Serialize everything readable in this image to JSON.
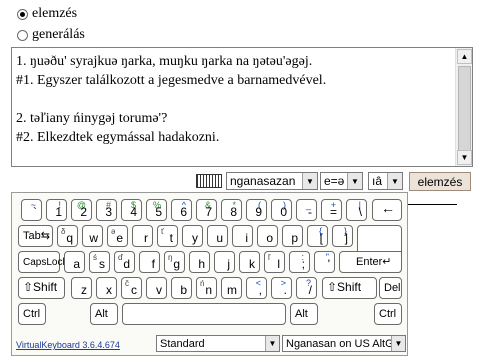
{
  "mode": {
    "options": [
      {
        "label": "elemzés",
        "checked": true
      },
      {
        "label": "generálás",
        "checked": false
      }
    ]
  },
  "text_lines": [
    "1. ŋuəðu' syrajkuə ŋarka, muŋku ŋarka na ŋətəu'əgəj.",
    "#1. Egyszer találkozott a jegesmedve a barnamedvével.",
    "",
    "2. təľiany ńinygəj torumə'?",
    "#2. Elkezdtek egymással hadakozni."
  ],
  "toolbar": {
    "keyboard_icon": "keyboard-icon",
    "language": "nganasazan",
    "mapping": "e=ə",
    "symbol": "ıâ",
    "analyze_label": "elemzés"
  },
  "keyboard": {
    "rows": [
      [
        {
          "id": "backtick",
          "sup": "",
          "sub": "",
          "main": "`",
          "alt": "~"
        },
        {
          "id": "1",
          "sup": "",
          "sub": "",
          "main": "1",
          "alt": "!"
        },
        {
          "id": "2",
          "sup": "",
          "sub": "",
          "main": "2",
          "alt": "@"
        },
        {
          "id": "3",
          "sup": "",
          "sub": "",
          "main": "3",
          "alt": "#"
        },
        {
          "id": "4",
          "sup": "",
          "sub": "",
          "main": "4",
          "alt": "$"
        },
        {
          "id": "5",
          "sup": "",
          "sub": "",
          "main": "5",
          "alt": "%"
        },
        {
          "id": "6",
          "sup": "",
          "sub": "",
          "main": "6",
          "alt": "^"
        },
        {
          "id": "7",
          "sup": "",
          "sub": "",
          "main": "7",
          "alt": "&"
        },
        {
          "id": "8",
          "sup": "",
          "sub": "",
          "main": "8",
          "alt": "*"
        },
        {
          "id": "9",
          "sup": "",
          "sub": "",
          "main": "9",
          "alt": "("
        },
        {
          "id": "0",
          "sup": "",
          "sub": "",
          "main": "0",
          "alt": ")"
        },
        {
          "id": "minus",
          "sup": "",
          "sub": "",
          "main": "-",
          "alt": "_"
        },
        {
          "id": "equals",
          "sup": "",
          "sub": "",
          "main": "=",
          "alt": "+"
        },
        {
          "id": "backslash",
          "sup": "",
          "sub": "",
          "main": "\\",
          "alt": "|"
        }
      ],
      [
        {
          "id": "q",
          "sub": "δ",
          "main": "q"
        },
        {
          "id": "w",
          "sub": "",
          "main": "w"
        },
        {
          "id": "e",
          "sub": "ə",
          "main": "e"
        },
        {
          "id": "r",
          "sub": "",
          "main": "r"
        },
        {
          "id": "t",
          "sub": "ť",
          "main": "t"
        },
        {
          "id": "y",
          "sub": "",
          "main": "y"
        },
        {
          "id": "u",
          "sub": "",
          "main": "u"
        },
        {
          "id": "i",
          "sub": "",
          "main": "i"
        },
        {
          "id": "o",
          "sub": "",
          "main": "o"
        },
        {
          "id": "p",
          "sub": "",
          "main": "p"
        },
        {
          "id": "lbracket",
          "sub": "",
          "main": "[",
          "alt": "{"
        },
        {
          "id": "rbracket",
          "sub": "",
          "main": "]",
          "alt": "}"
        }
      ],
      [
        {
          "id": "a",
          "sub": "",
          "main": "a"
        },
        {
          "id": "s",
          "sub": "ś",
          "main": "s"
        },
        {
          "id": "d",
          "sub": "ď",
          "main": "d"
        },
        {
          "id": "f",
          "sub": "",
          "main": "f"
        },
        {
          "id": "g",
          "sub": "ŋ",
          "main": "g"
        },
        {
          "id": "h",
          "sub": "",
          "main": "h"
        },
        {
          "id": "j",
          "sub": "",
          "main": "j"
        },
        {
          "id": "k",
          "sub": "",
          "main": "k"
        },
        {
          "id": "l",
          "sub": "ľ",
          "main": "l"
        },
        {
          "id": "semicolon",
          "sub": "",
          "main": ";",
          "alt": ":"
        },
        {
          "id": "quote",
          "sub": "",
          "main": "'",
          "alt": "\""
        }
      ],
      [
        {
          "id": "z",
          "sub": "",
          "main": "z"
        },
        {
          "id": "x",
          "sub": "",
          "main": "x"
        },
        {
          "id": "c",
          "sub": "č",
          "main": "c"
        },
        {
          "id": "v",
          "sub": "",
          "main": "v"
        },
        {
          "id": "b",
          "sub": "",
          "main": "b"
        },
        {
          "id": "n",
          "sub": "ń",
          "main": "n"
        },
        {
          "id": "m",
          "sub": "",
          "main": "m"
        },
        {
          "id": "comma",
          "sub": "",
          "main": ",",
          "alt": "<"
        },
        {
          "id": "period",
          "sub": "",
          "main": ".",
          "alt": ">"
        },
        {
          "id": "slash",
          "sub": "",
          "main": "/",
          "alt": "?"
        }
      ]
    ],
    "func": {
      "backspace": "←",
      "tab": "Tab⇆",
      "capslock": "CapsLock",
      "enter": "Enter↵",
      "shift_left": "⇧Shift",
      "shift_right": "⇧Shift",
      "del": "Del",
      "ctrl_left": "Ctrl",
      "alt_left": "Alt",
      "alt_right": "Alt",
      "ctrl_right": "Ctrl"
    }
  },
  "footer": {
    "version_link": "VirtualKeyboard 3.6.4.674",
    "layout_select": "Standard",
    "language_select": "Nganasan on US AltG"
  }
}
